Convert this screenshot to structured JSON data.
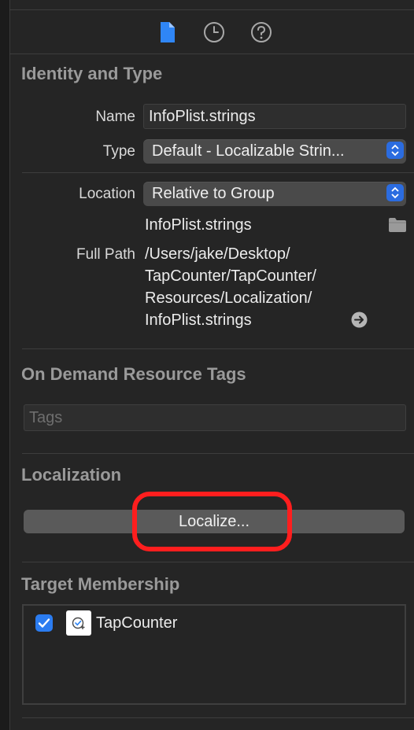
{
  "inspector_tabs": [
    {
      "name": "file-inspector",
      "icon": "document-icon",
      "active": true
    },
    {
      "name": "history-inspector",
      "icon": "clock-icon",
      "active": false
    },
    {
      "name": "quick-help-inspector",
      "icon": "question-icon",
      "active": false
    }
  ],
  "identity": {
    "title": "Identity and Type",
    "name_label": "Name",
    "name_value": "InfoPlist.strings",
    "type_label": "Type",
    "type_value": "Default - Localizable Strin...",
    "location_label": "Location",
    "location_value": "Relative to Group",
    "location_filename": "InfoPlist.strings",
    "full_path_label": "Full Path",
    "full_path_lines": [
      "/Users/jake/Desktop/",
      "TapCounter/TapCounter/",
      "Resources/Localization/",
      "InfoPlist.strings"
    ]
  },
  "on_demand": {
    "title": "On Demand Resource Tags",
    "tags_placeholder": "Tags"
  },
  "localization": {
    "title": "Localization",
    "button_label": "Localize..."
  },
  "target_membership": {
    "title": "Target Membership",
    "targets": [
      {
        "name": "TapCounter",
        "checked": true
      }
    ]
  },
  "colors": {
    "accent": "#2b7cf0",
    "highlight": "#ff1e1e",
    "background": "#252525"
  }
}
